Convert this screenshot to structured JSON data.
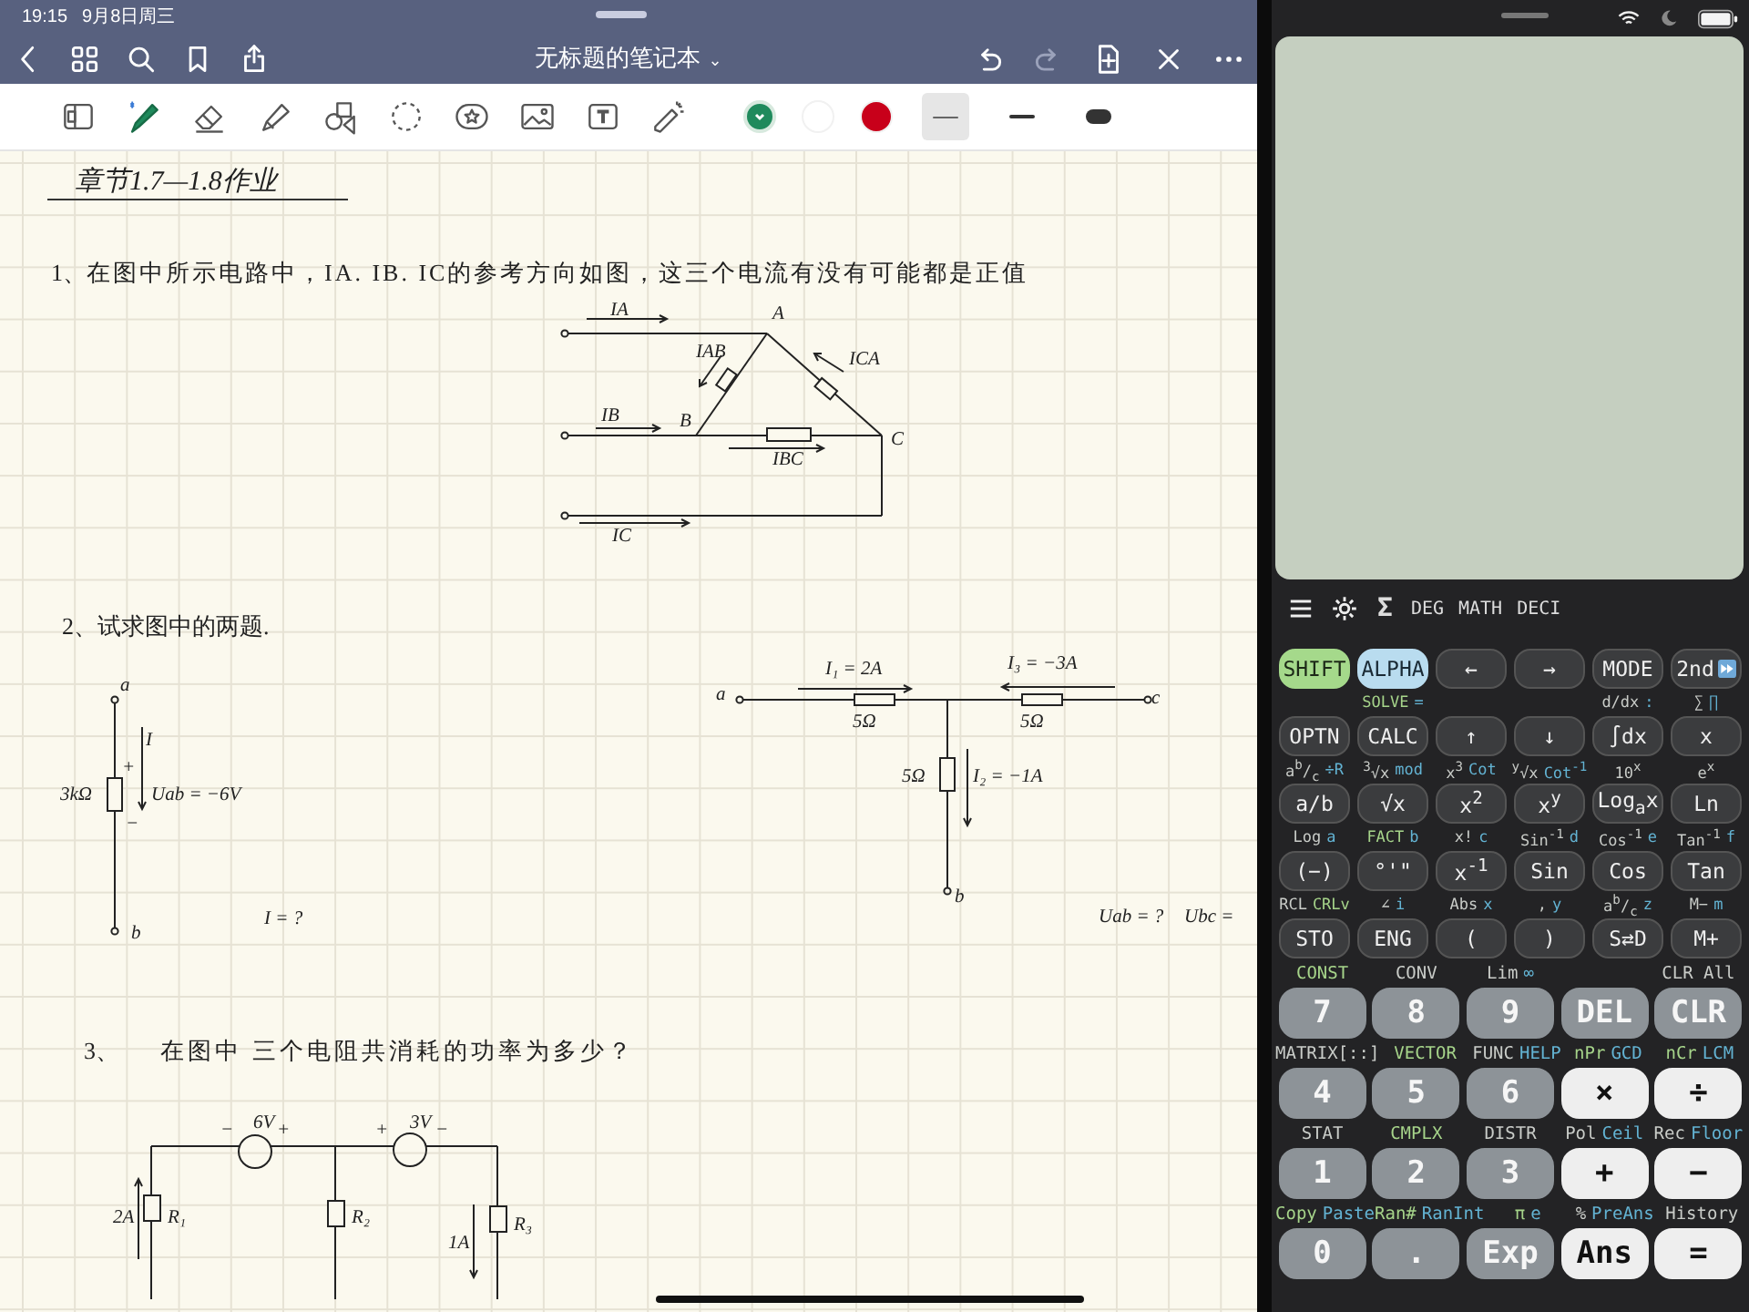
{
  "status_bar": {
    "time": "19:15",
    "date": "9月8日周三"
  },
  "nav": {
    "left": [
      {
        "kind": "back"
      },
      {
        "kind": "grid"
      },
      {
        "kind": "search"
      },
      {
        "kind": "bookmark"
      },
      {
        "kind": "share"
      }
    ],
    "title": "无标题的笔记本",
    "title_caret": "⌄",
    "right": [
      {
        "kind": "undo",
        "disabled": false
      },
      {
        "kind": "redo",
        "disabled": true
      },
      {
        "kind": "add-page",
        "disabled": false
      },
      {
        "kind": "close",
        "disabled": false
      },
      {
        "kind": "more",
        "disabled": false
      }
    ]
  },
  "toolbar": {
    "tools": [
      {
        "kind": "sidebar",
        "selected": false
      },
      {
        "kind": "pen",
        "selected": true
      },
      {
        "kind": "eraser",
        "selected": false
      },
      {
        "kind": "highlighter",
        "selected": false
      },
      {
        "kind": "shapes",
        "selected": false
      },
      {
        "kind": "lasso",
        "selected": false
      },
      {
        "kind": "sticker",
        "selected": false
      },
      {
        "kind": "image",
        "selected": false
      },
      {
        "kind": "text",
        "selected": false
      },
      {
        "kind": "laser",
        "selected": false
      }
    ],
    "colors": [
      {
        "color": "#1f8a5c",
        "selected": true
      },
      {
        "color": "#ffffff",
        "selected": false
      },
      {
        "color": "#c8001a",
        "selected": false
      }
    ],
    "widths": [
      {
        "kind": "thin",
        "selected": true
      },
      {
        "kind": "medium",
        "selected": false
      },
      {
        "kind": "thick",
        "selected": false
      }
    ]
  },
  "note": {
    "heading": "章节1.7—1.8作业",
    "questions": [
      {
        "number": "1、",
        "text": "在图中所示电路中，IA. IB. IC的参考方向如图，这三个电流有没有可能都是正值",
        "circuits": [
          {
            "kind": "delta",
            "labels": [
              "IA",
              "A",
              "IAB",
              "ICA",
              "IB",
              "B",
              "C",
              "IBC",
              "IC"
            ]
          }
        ]
      },
      {
        "number": "2、",
        "text": "试求图中的两题.",
        "circuits": [
          {
            "kind": "resistor",
            "labels": [
              "a",
              "I",
              "+",
              "3kΩ",
              "Uab = −6V",
              "−",
              "b",
              "I = ?"
            ]
          },
          {
            "kind": "tee",
            "labels": [
              "a",
              "I₁ = 2A",
              "I₃ = −3A",
              "c",
              "5Ω",
              "5Ω",
              "5Ω",
              "I₂ = −1A",
              "b",
              "Uab = ?",
              "Ubc ="
            ]
          }
        ]
      },
      {
        "number": "3、",
        "text": "在图中 三个电阻共消耗的功率为多少？",
        "circuits": [
          {
            "kind": "sources",
            "labels": [
              "−",
              "6V",
              "+",
              "+",
              "3V",
              "−",
              "2A",
              "R₁",
              "R₂",
              "1A",
              "R₃"
            ]
          }
        ]
      }
    ]
  },
  "calculator": {
    "sigma": "Σ",
    "modes": [
      "DEG",
      "MATH",
      "DECI"
    ],
    "rows": [
      {
        "kind": "small",
        "keys": [
          {
            "label": "SHIFT",
            "kind": "shift"
          },
          {
            "label": "ALPHA",
            "kind": "alpha"
          },
          {
            "label": "←",
            "kind": "dark"
          },
          {
            "label": "→",
            "kind": "dark"
          },
          {
            "label": "MODE",
            "kind": "dark"
          },
          {
            "label": "2nd",
            "kind": "dark"
          }
        ]
      },
      {
        "kind": "small",
        "keys": [
          {
            "label": "OPTN",
            "kind": "dark"
          },
          {
            "label": "CALC",
            "kind": "dark",
            "above": [
              {
                "text": "SOLVE",
                "kind": "shift"
              },
              {
                "text": "=",
                "kind": "alpha"
              }
            ]
          },
          {
            "label": "↑",
            "kind": "dark"
          },
          {
            "label": "↓",
            "kind": "dark"
          },
          {
            "label": "∫dx",
            "kind": "dark",
            "above": [
              {
                "text": "d/dx",
                "kind": "plain"
              },
              {
                "text": ":",
                "kind": "alpha"
              }
            ]
          },
          {
            "label": "x",
            "kind": "dark",
            "above": [
              {
                "text": "∑",
                "kind": "plain"
              },
              {
                "text": "∏",
                "kind": "alpha"
              }
            ]
          }
        ]
      },
      {
        "kind": "small",
        "keys": [
          {
            "label": "a/b",
            "kind": "dark",
            "above": [
              {
                "text": "a$^{b}$/$_{c}$",
                "kind": "plain"
              },
              {
                "text": "÷R",
                "kind": "alpha"
              }
            ]
          },
          {
            "label": "√x",
            "kind": "dark",
            "above": [
              {
                "text": "$^{3}$√x",
                "kind": "plain"
              },
              {
                "text": "mod",
                "kind": "alpha"
              }
            ]
          },
          {
            "label": "x$^{2}$",
            "kind": "dark",
            "above": [
              {
                "text": "x$^{3}$",
                "kind": "plain"
              },
              {
                "text": "Cot",
                "kind": "alpha"
              }
            ]
          },
          {
            "label": "x$^{y}$",
            "kind": "dark",
            "above": [
              {
                "text": "$^{y}$√x",
                "kind": "plain"
              },
              {
                "text": "Cot$^{-1}$",
                "kind": "alpha"
              }
            ]
          },
          {
            "label": "Log$_{a}$x",
            "kind": "dark",
            "above": [
              {
                "text": "10$^{x}$",
                "kind": "plain"
              }
            ]
          },
          {
            "label": "Ln",
            "kind": "dark",
            "above": [
              {
                "text": "e$^{x}$",
                "kind": "plain"
              }
            ]
          }
        ]
      },
      {
        "kind": "small",
        "keys": [
          {
            "label": "(−)",
            "kind": "dark",
            "above": [
              {
                "text": "Log",
                "kind": "plain"
              },
              {
                "text": "a",
                "kind": "alpha"
              }
            ]
          },
          {
            "label": "°'\"",
            "kind": "dark",
            "above": [
              {
                "text": "FACT",
                "kind": "shift"
              },
              {
                "text": "b",
                "kind": "alpha"
              }
            ]
          },
          {
            "label": "x$^{-1}$",
            "kind": "dark",
            "above": [
              {
                "text": "x!",
                "kind": "plain"
              },
              {
                "text": "c",
                "kind": "alpha"
              }
            ]
          },
          {
            "label": "Sin",
            "kind": "dark",
            "above": [
              {
                "text": "Sin$^{-1}$",
                "kind": "plain"
              },
              {
                "text": "d",
                "kind": "alpha"
              }
            ]
          },
          {
            "label": "Cos",
            "kind": "dark",
            "above": [
              {
                "text": "Cos$^{-1}$",
                "kind": "plain"
              },
              {
                "text": "e",
                "kind": "alpha"
              }
            ]
          },
          {
            "label": "Tan",
            "kind": "dark",
            "above": [
              {
                "text": "Tan$^{-1}$",
                "kind": "plain"
              },
              {
                "text": "f",
                "kind": "alpha"
              }
            ]
          }
        ]
      },
      {
        "kind": "small",
        "keys": [
          {
            "label": "STO",
            "kind": "dark",
            "above": [
              {
                "text": "RCL",
                "kind": "plain"
              },
              {
                "text": "CRLv",
                "kind": "shift"
              }
            ]
          },
          {
            "label": "ENG",
            "kind": "dark",
            "above": [
              {
                "text": "∠",
                "kind": "plain"
              },
              {
                "text": "i",
                "kind": "alpha"
              }
            ]
          },
          {
            "label": "(",
            "kind": "dark",
            "above": [
              {
                "text": "Abs",
                "kind": "plain"
              },
              {
                "text": "x",
                "kind": "alpha"
              }
            ]
          },
          {
            "label": ")",
            "kind": "dark",
            "above": [
              {
                "text": ",",
                "kind": "plain"
              },
              {
                "text": "y",
                "kind": "alpha"
              }
            ]
          },
          {
            "label": "S⇄D",
            "kind": "dark",
            "above": [
              {
                "text": "a$^{b}$/$_{c}$",
                "kind": "plain"
              },
              {
                "text": "z",
                "kind": "alpha"
              }
            ]
          },
          {
            "label": "M+",
            "kind": "dark",
            "above": [
              {
                "text": "M−",
                "kind": "plain"
              },
              {
                "text": "m",
                "kind": "alpha"
              }
            ]
          }
        ]
      },
      {
        "kind": "big",
        "keys": [
          {
            "label": "7",
            "kind": "num",
            "above": [
              {
                "text": "CONST",
                "kind": "shift"
              }
            ]
          },
          {
            "label": "8",
            "kind": "num",
            "above": [
              {
                "text": "CONV",
                "kind": "plain"
              }
            ]
          },
          {
            "label": "9",
            "kind": "num",
            "above": [
              {
                "text": "Lim",
                "kind": "plain"
              },
              {
                "text": "∞",
                "kind": "alpha"
              }
            ]
          },
          {
            "label": "DEL",
            "kind": "num"
          },
          {
            "label": "CLR",
            "kind": "num",
            "above": [
              {
                "text": "CLR All",
                "kind": "plain"
              }
            ]
          }
        ]
      },
      {
        "kind": "big",
        "keys": [
          {
            "label": "4",
            "kind": "num",
            "above": [
              {
                "text": "MATRIX[::]",
                "kind": "plain"
              }
            ]
          },
          {
            "label": "5",
            "kind": "num",
            "above": [
              {
                "text": "VECTOR",
                "kind": "shift"
              }
            ]
          },
          {
            "label": "6",
            "kind": "num",
            "above": [
              {
                "text": "FUNC",
                "kind": "plain"
              },
              {
                "text": "HELP",
                "kind": "alpha"
              }
            ]
          },
          {
            "label": "×",
            "kind": "light",
            "above": [
              {
                "text": "nPr",
                "kind": "shift"
              },
              {
                "text": "GCD",
                "kind": "alpha"
              }
            ]
          },
          {
            "label": "÷",
            "kind": "light",
            "above": [
              {
                "text": "nCr",
                "kind": "shift"
              },
              {
                "text": "LCM",
                "kind": "alpha"
              }
            ]
          }
        ]
      },
      {
        "kind": "big",
        "keys": [
          {
            "label": "1",
            "kind": "num",
            "above": [
              {
                "text": "STAT",
                "kind": "plain"
              }
            ]
          },
          {
            "label": "2",
            "kind": "num",
            "above": [
              {
                "text": "CMPLX",
                "kind": "shift"
              }
            ]
          },
          {
            "label": "3",
            "kind": "num",
            "above": [
              {
                "text": "DISTR",
                "kind": "plain"
              }
            ]
          },
          {
            "label": "+",
            "kind": "light",
            "above": [
              {
                "text": "Pol",
                "kind": "plain"
              },
              {
                "text": "Ceil",
                "kind": "alpha"
              }
            ]
          },
          {
            "label": "−",
            "kind": "light",
            "above": [
              {
                "text": "Rec",
                "kind": "plain"
              },
              {
                "text": "Floor",
                "kind": "alpha"
              }
            ]
          }
        ]
      },
      {
        "kind": "big",
        "keys": [
          {
            "label": "0",
            "kind": "num",
            "above": [
              {
                "text": "Copy",
                "kind": "shift"
              },
              {
                "text": "Paste",
                "kind": "alpha"
              }
            ]
          },
          {
            "label": ".",
            "kind": "num",
            "above": [
              {
                "text": "Ran#",
                "kind": "shift"
              },
              {
                "text": "RanInt",
                "kind": "alpha"
              }
            ]
          },
          {
            "label": "Exp",
            "kind": "num",
            "above": [
              {
                "text": "π",
                "kind": "shift"
              },
              {
                "text": "e",
                "kind": "alpha"
              }
            ]
          },
          {
            "label": "Ans",
            "kind": "light",
            "above": [
              {
                "text": "%",
                "kind": "plain"
              },
              {
                "text": "PreAns",
                "kind": "alpha"
              }
            ]
          },
          {
            "label": "=",
            "kind": "light",
            "above": [
              {
                "text": "History",
                "kind": "plain"
              }
            ]
          }
        ]
      }
    ]
  }
}
